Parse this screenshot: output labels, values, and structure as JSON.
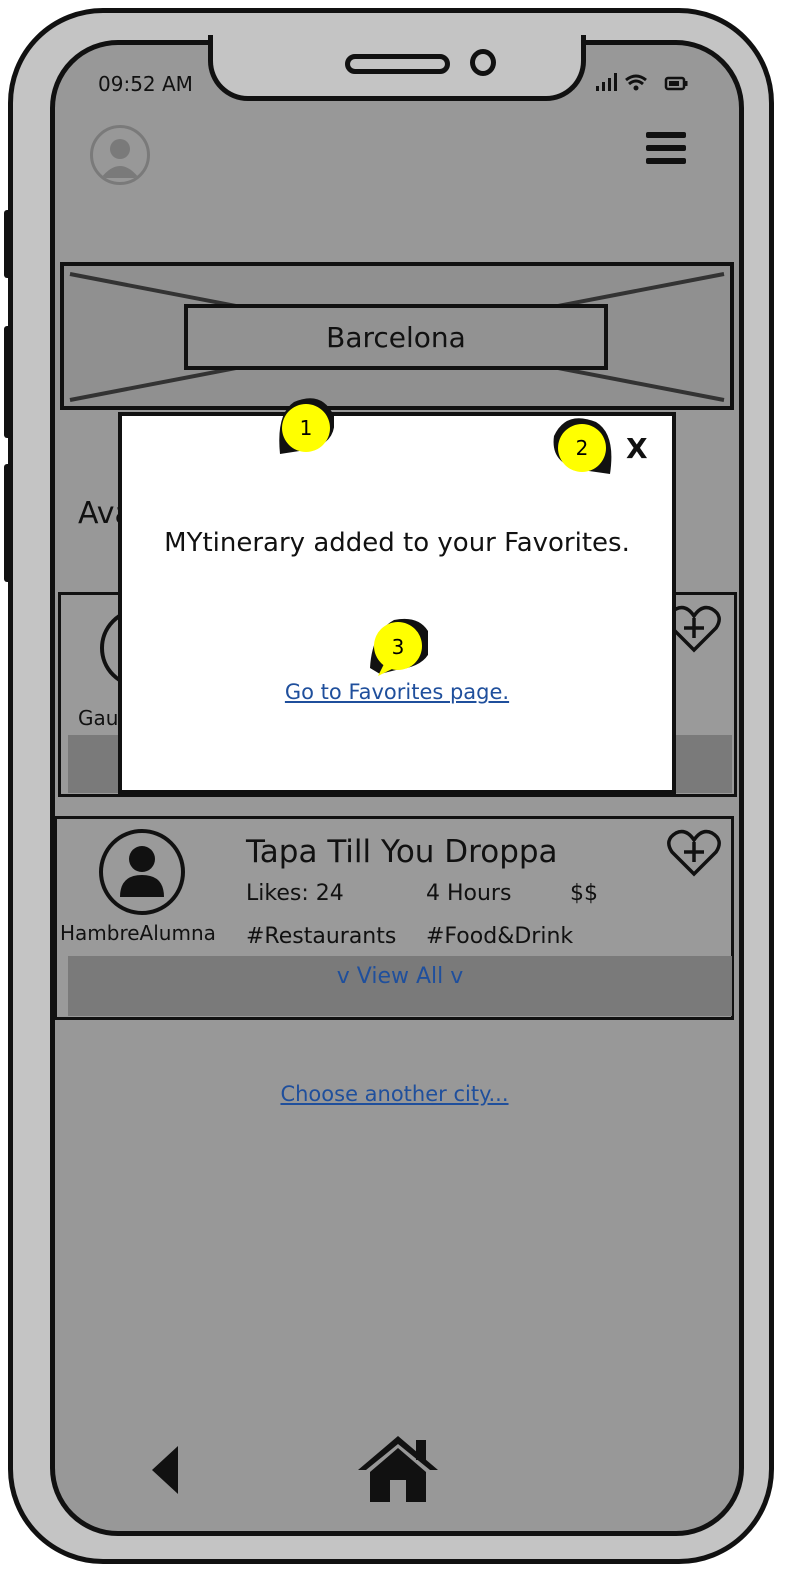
{
  "status_bar": {
    "time": "09:52 AM",
    "icons": "..ıl ☰ ▭"
  },
  "header": {
    "avatar_icon": "user-avatar-icon",
    "menu_icon": "hamburger-menu-icon"
  },
  "banner": {
    "city": "Barcelona"
  },
  "section": {
    "title_partial": "Ava"
  },
  "itineraries": [
    {
      "user_partial": "Gau",
      "favorite_icon": "heart-plus-icon"
    },
    {
      "title": "Tapa Till You Droppa",
      "user": "HambreAlumna",
      "likes": "Likes: 24",
      "duration": "4 Hours",
      "price": "$$",
      "tags": [
        "#Restaurants",
        "#Food&Drink"
      ],
      "view_all": "v View All v",
      "favorite_icon": "heart-plus-icon"
    }
  ],
  "footer_link": "Choose another city...",
  "nav": {
    "back_icon": "back-triangle-icon",
    "home_icon": "home-icon"
  },
  "modal": {
    "message": "MYtinerary added to your Favorites.",
    "link": "Go to Favorites page.",
    "close": "X"
  },
  "callouts": [
    "1",
    "2",
    "3"
  ],
  "colors": {
    "screen": "#989898",
    "link": "#1f4f9c",
    "callout": "#ffff00",
    "frame": "#c4c4c4"
  }
}
